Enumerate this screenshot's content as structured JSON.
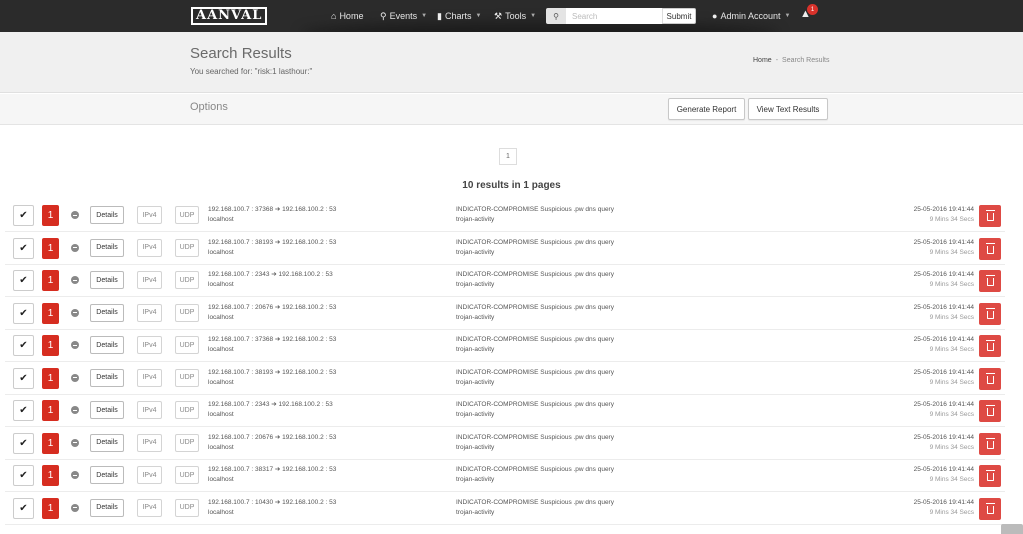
{
  "nav": {
    "logo": "AANVAL",
    "home": "Home",
    "events": "Events",
    "charts": "Charts",
    "tools": "Tools",
    "search_placeholder": "Search",
    "submit": "Submit",
    "account": "Admin Account",
    "notifications": "1"
  },
  "header": {
    "title": "Search Results",
    "subtitle": "You searched for: \"risk:1 lasthour:\"",
    "breadcrumb_home": "Home",
    "breadcrumb_sep": "-",
    "breadcrumb_current": "Search Results"
  },
  "options": {
    "label": "Options",
    "generate_report": "Generate Report",
    "view_text": "View Text Results"
  },
  "pagination": {
    "current_page": "1"
  },
  "results_summary": "10 results in 1 pages",
  "rows": [
    {
      "risk": "1",
      "details": "Details",
      "ip_version": "IPv4",
      "protocol": "UDP",
      "connection": "192.168.100.7 : 37368 ➔ 192.168.100.2 : 53",
      "host": "localhost",
      "signature": "INDICATOR-COMPROMISE Suspicious .pw dns query",
      "classification": "trojan-activity",
      "timestamp": "25-05-2016 19:41:44",
      "age": "9 Mins 34 Secs"
    },
    {
      "risk": "1",
      "details": "Details",
      "ip_version": "IPv4",
      "protocol": "UDP",
      "connection": "192.168.100.7 : 38193 ➔ 192.168.100.2 : 53",
      "host": "localhost",
      "signature": "INDICATOR-COMPROMISE Suspicious .pw dns query",
      "classification": "trojan-activity",
      "timestamp": "25-05-2016 19:41:44",
      "age": "9 Mins 34 Secs"
    },
    {
      "risk": "1",
      "details": "Details",
      "ip_version": "IPv4",
      "protocol": "UDP",
      "connection": "192.168.100.7 : 2343 ➔ 192.168.100.2 : 53",
      "host": "localhost",
      "signature": "INDICATOR-COMPROMISE Suspicious .pw dns query",
      "classification": "trojan-activity",
      "timestamp": "25-05-2016 19:41:44",
      "age": "9 Mins 34 Secs"
    },
    {
      "risk": "1",
      "details": "Details",
      "ip_version": "IPv4",
      "protocol": "UDP",
      "connection": "192.168.100.7 : 20676 ➔ 192.168.100.2 : 53",
      "host": "localhost",
      "signature": "INDICATOR-COMPROMISE Suspicious .pw dns query",
      "classification": "trojan-activity",
      "timestamp": "25-05-2016 19:41:44",
      "age": "9 Mins 34 Secs"
    },
    {
      "risk": "1",
      "details": "Details",
      "ip_version": "IPv4",
      "protocol": "UDP",
      "connection": "192.168.100.7 : 37368 ➔ 192.168.100.2 : 53",
      "host": "localhost",
      "signature": "INDICATOR-COMPROMISE Suspicious .pw dns query",
      "classification": "trojan-activity",
      "timestamp": "25-05-2016 19:41:44",
      "age": "9 Mins 34 Secs"
    },
    {
      "risk": "1",
      "details": "Details",
      "ip_version": "IPv4",
      "protocol": "UDP",
      "connection": "192.168.100.7 : 38193 ➔ 192.168.100.2 : 53",
      "host": "localhost",
      "signature": "INDICATOR-COMPROMISE Suspicious .pw dns query",
      "classification": "trojan-activity",
      "timestamp": "25-05-2016 19:41:44",
      "age": "9 Mins 34 Secs"
    },
    {
      "risk": "1",
      "details": "Details",
      "ip_version": "IPv4",
      "protocol": "UDP",
      "connection": "192.168.100.7 : 2343 ➔ 192.168.100.2 : 53",
      "host": "localhost",
      "signature": "INDICATOR-COMPROMISE Suspicious .pw dns query",
      "classification": "trojan-activity",
      "timestamp": "25-05-2016 19:41:44",
      "age": "9 Mins 34 Secs"
    },
    {
      "risk": "1",
      "details": "Details",
      "ip_version": "IPv4",
      "protocol": "UDP",
      "connection": "192.168.100.7 : 20676 ➔ 192.168.100.2 : 53",
      "host": "localhost",
      "signature": "INDICATOR-COMPROMISE Suspicious .pw dns query",
      "classification": "trojan-activity",
      "timestamp": "25-05-2016 19:41:44",
      "age": "9 Mins 34 Secs"
    },
    {
      "risk": "1",
      "details": "Details",
      "ip_version": "IPv4",
      "protocol": "UDP",
      "connection": "192.168.100.7 : 38317 ➔ 192.168.100.2 : 53",
      "host": "localhost",
      "signature": "INDICATOR-COMPROMISE Suspicious .pw dns query",
      "classification": "trojan-activity",
      "timestamp": "25-05-2016 19:41:44",
      "age": "9 Mins 34 Secs"
    },
    {
      "risk": "1",
      "details": "Details",
      "ip_version": "IPv4",
      "protocol": "UDP",
      "connection": "192.168.100.7 : 10430 ➔ 192.168.100.2 : 53",
      "host": "localhost",
      "signature": "INDICATOR-COMPROMISE Suspicious .pw dns query",
      "classification": "trojan-activity",
      "timestamp": "25-05-2016 19:41:44",
      "age": "9 Mins 34 Secs"
    }
  ],
  "colors": {
    "topbar": "#2b2b2b",
    "risk": "#d62d20",
    "delete": "#de4a44"
  },
  "icons": {
    "check": "check-icon",
    "minus": "minus-circle-icon",
    "trash": "trash-icon",
    "bell": "bell-icon",
    "user": "user-icon",
    "search": "search-icon"
  }
}
